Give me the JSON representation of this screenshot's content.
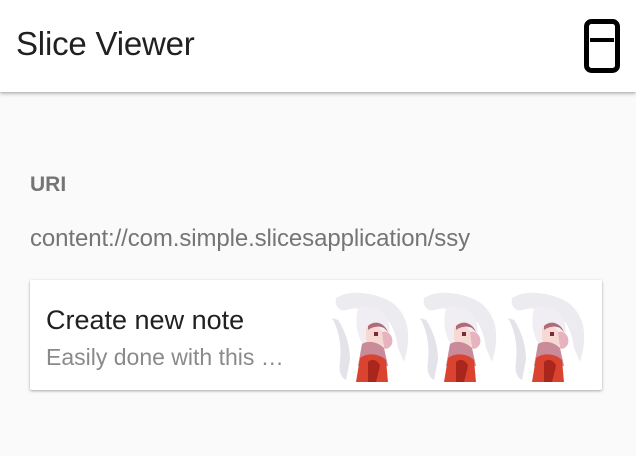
{
  "app_bar": {
    "title": "Slice Viewer",
    "action_icon": "phone-device-icon"
  },
  "main": {
    "uri_label": "URI",
    "uri_value": "content://com.simple.slicesapplication/ssy"
  },
  "slice": {
    "title": "Create new note",
    "subtitle": "Easily done with this …",
    "images": [
      {
        "icon": "anime-character-thumbnail"
      },
      {
        "icon": "anime-character-thumbnail"
      },
      {
        "icon": "anime-character-thumbnail"
      }
    ]
  },
  "colors": {
    "background": "#fafafa",
    "app_bar": "#ffffff",
    "title_text": "#212121",
    "secondary_text": "#757575",
    "card": "#ffffff"
  }
}
